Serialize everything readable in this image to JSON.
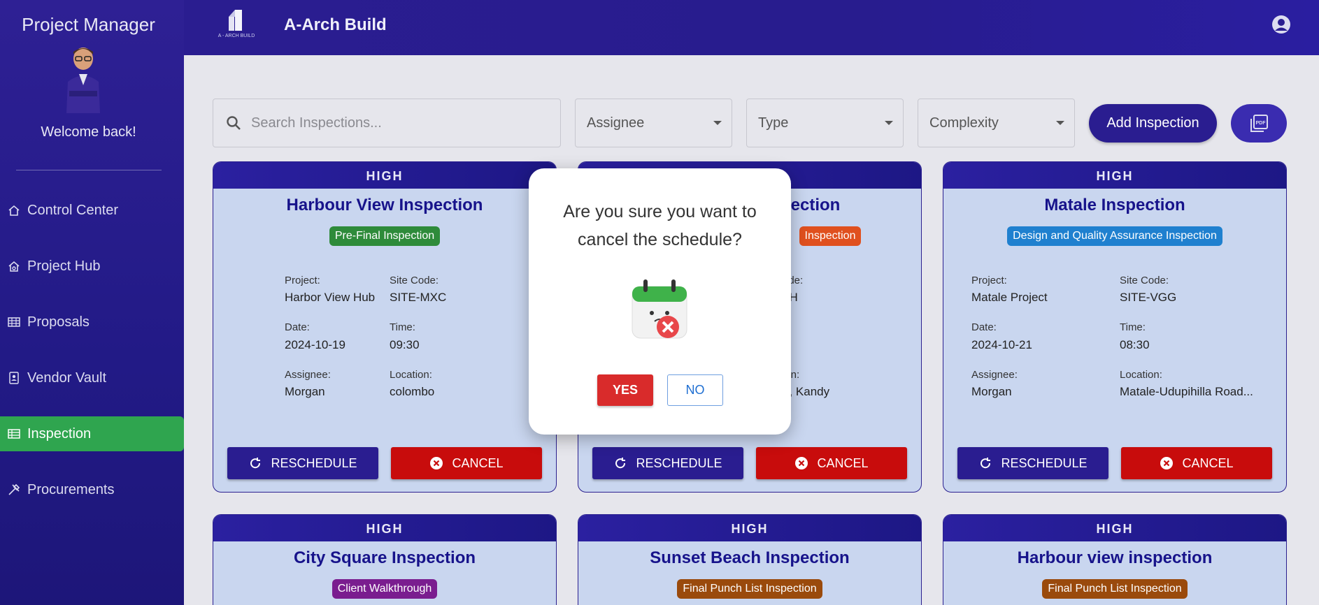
{
  "sidebar": {
    "title": "Project Manager",
    "welcome": "Welcome back!",
    "items": [
      {
        "label": "Control Center",
        "icon": "home-icon"
      },
      {
        "label": "Project Hub",
        "icon": "home-gear-icon"
      },
      {
        "label": "Proposals",
        "icon": "grid-icon"
      },
      {
        "label": "Vendor Vault",
        "icon": "badge-icon"
      },
      {
        "label": "Inspection",
        "icon": "table-icon",
        "active": true
      },
      {
        "label": "Procurements",
        "icon": "tools-icon"
      }
    ]
  },
  "header": {
    "logo_text": "A - ARCH BUILD",
    "title": "A-Arch Build"
  },
  "toolbar": {
    "search_placeholder": "Search Inspections...",
    "assignee": "Assignee",
    "type": "Type",
    "complexity": "Complexity",
    "add_label": "Add Inspection",
    "pdf_icon": "pdf-icon"
  },
  "labels": {
    "project": "Project:",
    "site_code": "Site Code:",
    "date": "Date:",
    "time": "Time:",
    "assignee": "Assignee:",
    "location": "Location:",
    "reschedule": "RESCHEDULE",
    "cancel": "CANCEL"
  },
  "cards": [
    {
      "priority": "HIGH",
      "title": "Harbour View Inspection",
      "tag": "Pre-Final Inspection",
      "tag_color": "#2e8b3a",
      "project": "Harbor View Hub",
      "site_code": "SITE-MXC",
      "date": "2024-10-19",
      "time": "09:30",
      "assignee": "Morgan",
      "location": "colombo"
    },
    {
      "priority": "HIGH",
      "title": "spection",
      "tag": "Inspection",
      "tag_color": "#e0501e",
      "project": "",
      "site_code": "8H",
      "date": "",
      "time": "",
      "assignee": "",
      "location": "a, Kandy"
    },
    {
      "priority": "HIGH",
      "title": "Matale Inspection",
      "tag": "Design and Quality Assurance Inspection",
      "tag_color": "#1f80cf",
      "project": "Matale Project",
      "site_code": "SITE-VGG",
      "date": "2024-10-21",
      "time": "08:30",
      "assignee": "Morgan",
      "location": "Matale-Udupihilla Road..."
    },
    {
      "priority": "HIGH",
      "title": "City Square Inspection",
      "tag": "Client Walkthrough",
      "tag_color": "#7a1d8f"
    },
    {
      "priority": "HIGH",
      "title": "Sunset Beach Inspection",
      "tag": "Final Punch List Inspection",
      "tag_color": "#9a4a0c"
    },
    {
      "priority": "HIGH",
      "title": "Harbour view inspection",
      "tag": "Final Punch List Inspection",
      "tag_color": "#9a4a0c"
    }
  ],
  "modal": {
    "message": "Are you sure you want to cancel the schedule?",
    "yes": "YES",
    "no": "NO"
  }
}
